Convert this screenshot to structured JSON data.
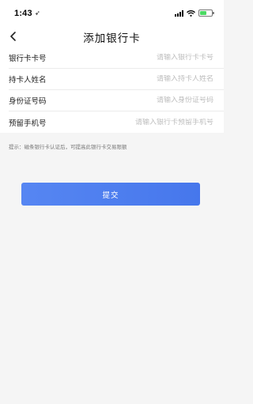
{
  "status_bar": {
    "time": "1:43",
    "location_glyph": "➶",
    "battery_level": 0.55,
    "battery_color": "#4cd964"
  },
  "header": {
    "back_icon": "chevron-left-icon",
    "title": "添加银行卡"
  },
  "form": {
    "fields": [
      {
        "label": "银行卡卡号",
        "placeholder": "请输入银行卡卡号",
        "value": ""
      },
      {
        "label": "持卡人姓名",
        "placeholder": "请输入持卡人姓名",
        "value": ""
      },
      {
        "label": "身份证号码",
        "placeholder": "请输入身份证号码",
        "value": ""
      },
      {
        "label": "预留手机号",
        "placeholder": "请输入银行卡预留手机号",
        "value": ""
      }
    ]
  },
  "hint": "提示：磁条银行卡认证后，可提高此银行卡交易限额",
  "submit": {
    "label": "提交",
    "color": "#4a7cee"
  }
}
